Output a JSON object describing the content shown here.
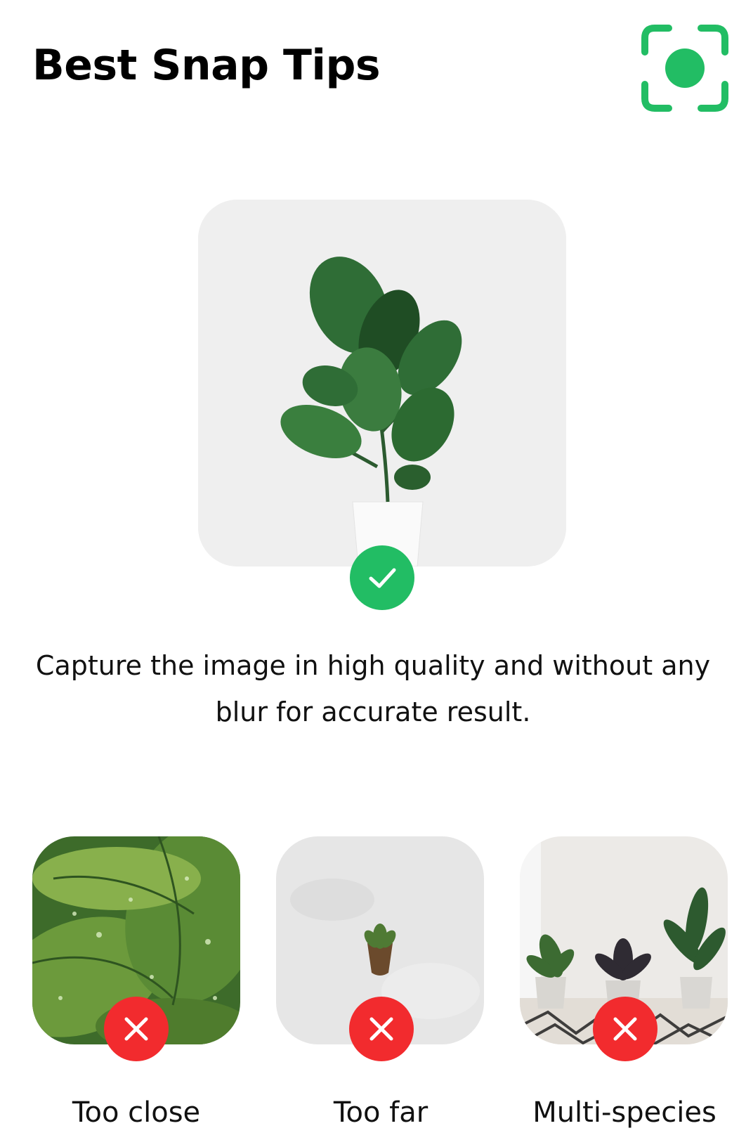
{
  "header": {
    "title": "Best Snap Tips",
    "scan_icon": "camera-scan-icon",
    "accent": "#22bd64"
  },
  "good_example": {
    "status_icon": "checkmark-icon",
    "status_color": "#22bd64",
    "description": "Capture the image in high quality and without any blur for accurate result."
  },
  "bad_examples": [
    {
      "label": "Too close",
      "status_icon": "cross-icon"
    },
    {
      "label": "Too far",
      "status_icon": "cross-icon"
    },
    {
      "label": "Multi-species",
      "status_icon": "cross-icon"
    }
  ],
  "error_color": "#f22b2e"
}
